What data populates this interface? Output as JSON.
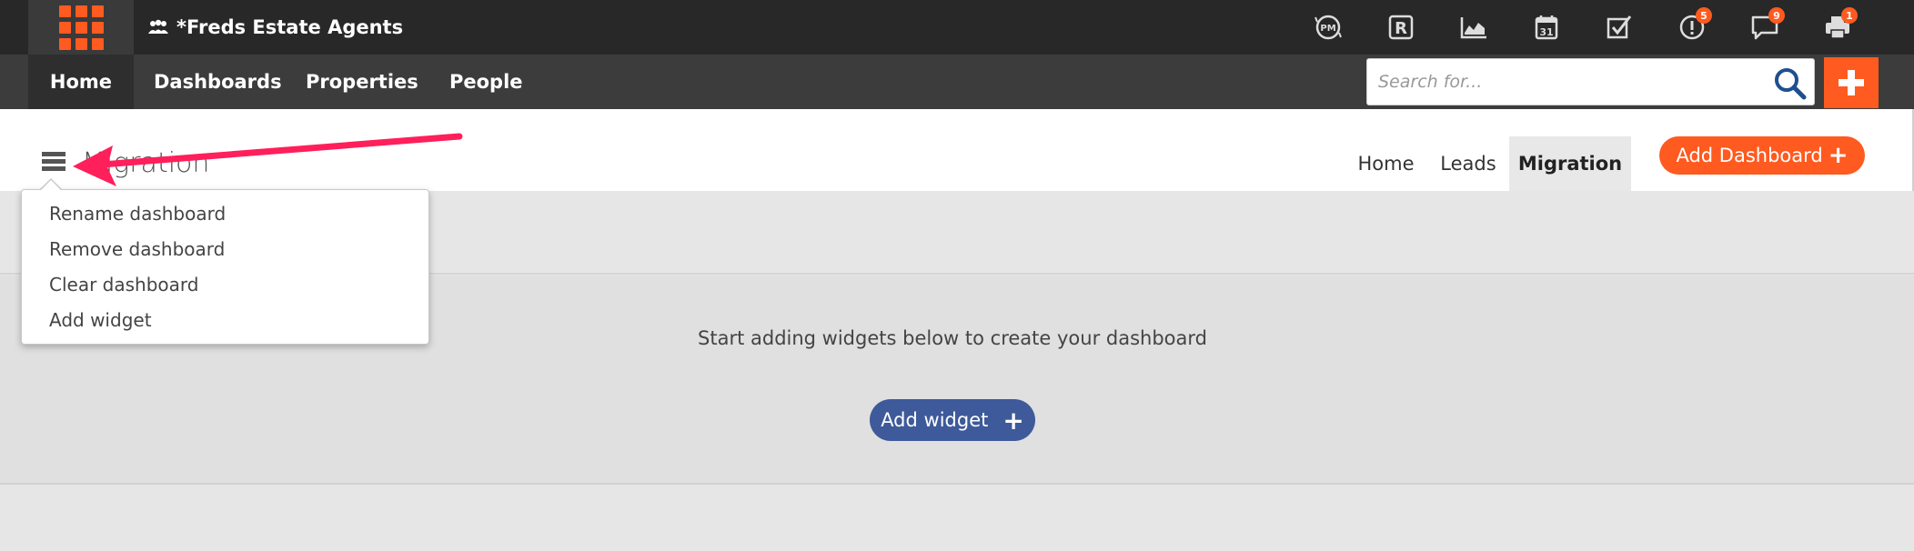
{
  "app": {
    "agency_name": "*Freds Estate Agents"
  },
  "top_icons": [
    {
      "name": "pm-icon",
      "badge": ""
    },
    {
      "name": "registered-icon",
      "badge": ""
    },
    {
      "name": "chart-icon",
      "badge": ""
    },
    {
      "name": "calendar-icon",
      "badge": ""
    },
    {
      "name": "checkbox-icon",
      "badge": ""
    },
    {
      "name": "alert-icon",
      "badge": "5"
    },
    {
      "name": "chat-icon",
      "badge": "9"
    },
    {
      "name": "printer-icon",
      "badge": "1"
    }
  ],
  "nav": {
    "items": [
      "Home",
      "Dashboards",
      "Properties",
      "People"
    ]
  },
  "search": {
    "placeholder": "Search for..."
  },
  "dashboard": {
    "title": "Migration",
    "tabs": [
      "Home",
      "Leads",
      "Migration"
    ],
    "active_tab": "Migration",
    "add_dashboard_label": "Add Dashboard",
    "empty_message": "Start adding widgets below to create your dashboard",
    "add_widget_label": "Add widget"
  },
  "menu": {
    "items": [
      "Rename dashboard",
      "Remove dashboard",
      "Clear dashboard",
      "Add widget"
    ]
  },
  "colors": {
    "accent": "#ff5a1f",
    "topbar": "#282828",
    "navbar": "#3c3c3c",
    "add_widget": "#3e5a9a",
    "annotation": "#ff1f5a"
  }
}
